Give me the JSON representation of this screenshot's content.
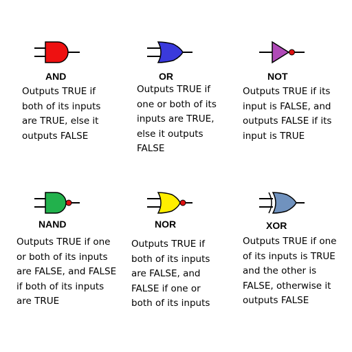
{
  "colors": {
    "and": "#ee1111",
    "or": "#3a3adc",
    "not": "#b04ab8",
    "nand": "#22b14c",
    "nor": "#ffee00",
    "xor": "#7092be",
    "bubble": "#dd1111",
    "stroke": "#000000"
  },
  "gates": [
    {
      "name": "AND",
      "icon": "and-gate-icon",
      "description": [
        "Outputs TRUE if",
        "both of its inputs",
        "are TRUE, else it",
        "outputs FALSE"
      ]
    },
    {
      "name": "OR",
      "icon": "or-gate-icon",
      "description": [
        "Outputs TRUE if",
        "one or both of its",
        "inputs are TRUE,",
        "else it outputs",
        "FALSE"
      ]
    },
    {
      "name": "NOT",
      "icon": "not-gate-icon",
      "description": [
        "Outputs TRUE if its",
        "input is FALSE, and",
        "outputs FALSE if its",
        "input is TRUE"
      ]
    },
    {
      "name": "NAND",
      "icon": "nand-gate-icon",
      "description": [
        "Outputs TRUE if one",
        "or both of its inputs",
        "are FALSE, and FALSE",
        "if both of its inputs",
        "are TRUE"
      ]
    },
    {
      "name": "NOR",
      "icon": "nor-gate-icon",
      "description": [
        "Outputs TRUE if",
        "both of its inputs",
        "are FALSE, and",
        "FALSE if one or",
        "both of its inputs"
      ]
    },
    {
      "name": "XOR",
      "icon": "xor-gate-icon",
      "description": [
        "Outputs TRUE if one",
        "of its inputs is TRUE",
        "and the other is",
        "FALSE, otherwise it",
        "outputs FALSE"
      ]
    }
  ]
}
